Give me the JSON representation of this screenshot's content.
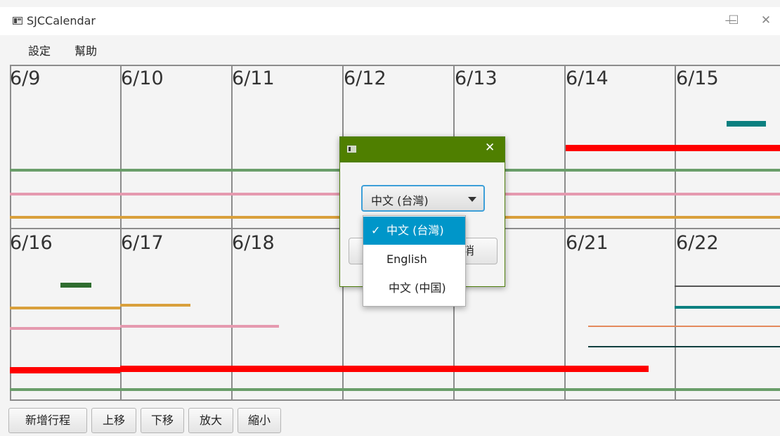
{
  "window": {
    "title": "SJCCalendar",
    "controls": {
      "minimize": "—",
      "maximize": "☐",
      "close": "✕"
    }
  },
  "menu": [
    "設定",
    "幫助"
  ],
  "calendar": {
    "week1": [
      "6/9",
      "6/10",
      "6/11",
      "6/12",
      "6/13",
      "6/14",
      "6/15"
    ],
    "week2": [
      "6/16",
      "6/17",
      "6/18",
      "6/21",
      "6/22"
    ],
    "event_colors": {
      "green": "#6a9e6a",
      "pink": "#e59aaf",
      "orange": "#d9a03c",
      "red": "#ff0000",
      "teal": "#0a8080",
      "dark_green": "#2f6d2f",
      "salmon": "#e48a5c",
      "dark_teal": "#114040",
      "gray": "#555555"
    }
  },
  "dialog": {
    "close": "✕",
    "title_color": "#4f7f00",
    "language_select": {
      "selected": "中文 (台灣)"
    },
    "cancel_partial": "消"
  },
  "language_options": [
    {
      "label": "中文 (台灣)",
      "checked": true,
      "check": "✓"
    },
    {
      "label": "English",
      "checked": false
    },
    {
      "label": "中文 (中国)",
      "checked": false
    }
  ],
  "toolbar": {
    "add_event": "新增行程",
    "move_up": "上移",
    "move_down": "下移",
    "zoom_in": "放大",
    "zoom_out": "縮小"
  }
}
